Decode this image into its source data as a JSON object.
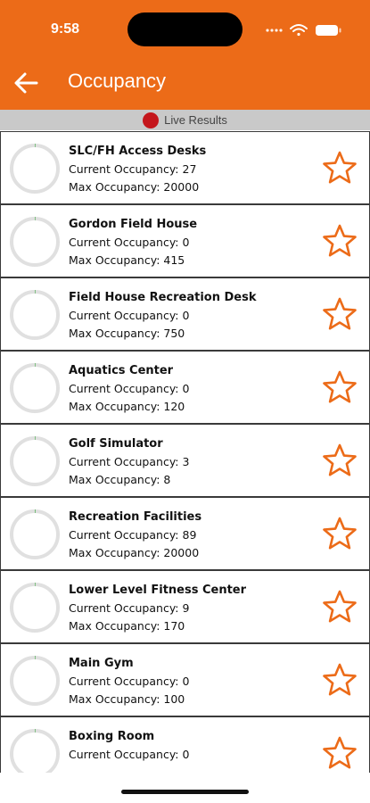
{
  "status_bar": {
    "time": "9:58"
  },
  "header": {
    "title": "Occupancy"
  },
  "live_bar": {
    "label": "Live Results"
  },
  "colors": {
    "accent": "#ec6b18",
    "live": "#c4161c",
    "ring_track": "#e0e0e0",
    "ring_fill": "#4caf50"
  },
  "facilities": [
    {
      "name": "SLC/FH Access Desks",
      "current": "Current Occupancy: 27",
      "max": "Max Occupancy: 20000",
      "fill": 0.0014
    },
    {
      "name": "Gordon Field House",
      "current": "Current Occupancy: 0",
      "max": "Max Occupancy: 415",
      "fill": 0
    },
    {
      "name": "Field House Recreation Desk",
      "current": "Current Occupancy: 0",
      "max": "Max Occupancy: 750",
      "fill": 0
    },
    {
      "name": "Aquatics Center",
      "current": "Current Occupancy: 0",
      "max": "Max Occupancy: 120",
      "fill": 0
    },
    {
      "name": "Golf Simulator",
      "current": "Current Occupancy: 3",
      "max": "Max Occupancy: 8",
      "fill": 0
    },
    {
      "name": "Recreation Facilities",
      "current": "Current Occupancy: 89",
      "max": "Max Occupancy: 20000",
      "fill": 0.0045
    },
    {
      "name": "Lower Level Fitness Center",
      "current": "Current Occupancy: 9",
      "max": "Max Occupancy: 170",
      "fill": 0
    },
    {
      "name": "Main Gym",
      "current": "Current Occupancy: 0",
      "max": "Max Occupancy: 100",
      "fill": 0
    },
    {
      "name": "Boxing Room",
      "current": "Current Occupancy: 0",
      "max": "",
      "fill": 0
    }
  ]
}
